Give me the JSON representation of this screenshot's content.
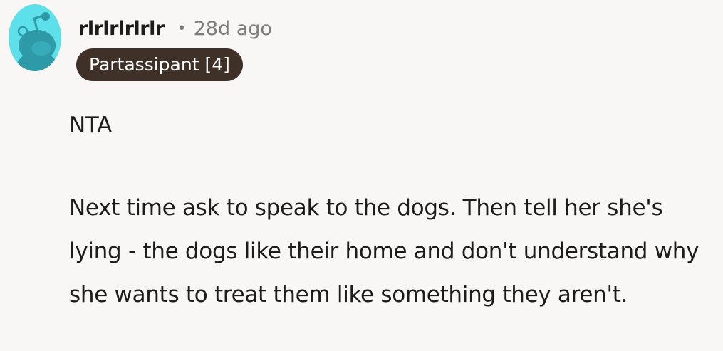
{
  "comment": {
    "author": "rlrlrlrlrlr",
    "separator": "•",
    "time_ago": "28d ago",
    "flair": "Partassipant [4]",
    "avatar_icon": "snoo-avatar-icon",
    "colors": {
      "avatar_bg": "#5ee0ea",
      "avatar_body": "#2e9aa8",
      "flair_bg": "#3f3128",
      "flair_text": "#ffffff",
      "meta_text": "#7c7c7c"
    },
    "body": {
      "verdict": "NTA",
      "text": "Next time ask to speak to the dogs. Then tell her she's lying - the dogs like their home and don't understand why she wants to treat them like something they aren't."
    }
  }
}
